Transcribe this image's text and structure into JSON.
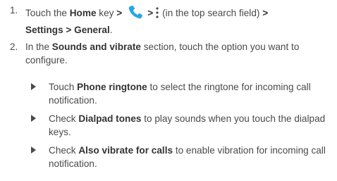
{
  "colors": {
    "text": "#4a4a4a",
    "bold_text": "#333333",
    "phone_icon": "#29a8e0",
    "background": "#ffffff"
  },
  "step1": {
    "number": "1.",
    "touch": "Touch the ",
    "home_key": "Home",
    "key": " key ",
    "arrow1": ">",
    "phone_icon": "phone-icon",
    "arrow2": ">",
    "menu_icon": "menu-icon",
    "menu_hint": "(in the top search field) ",
    "arrow3": ">",
    "settings_path": "Settings > General",
    "end": "."
  },
  "step2": {
    "number": "2.",
    "prefix": "In the ",
    "section": "Sounds and vibrate",
    "suffix": " section, touch the option you want to configure."
  },
  "bullets": [
    {
      "pre": "Touch ",
      "bold": "Phone ringtone",
      "post": " to select the ringtone for incoming call notification."
    },
    {
      "pre": "Check ",
      "bold": "Dialpad tones",
      "post": " to play sounds when you touch the dialpad keys."
    },
    {
      "pre": "Check ",
      "bold": "Also vibrate for calls",
      "post": " to enable vibration for incoming call notification."
    }
  ]
}
